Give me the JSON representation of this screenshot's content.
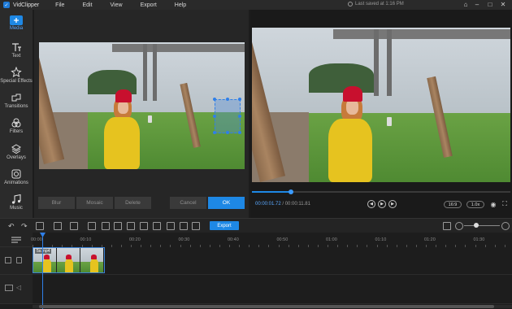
{
  "app": {
    "name": "VidClipper",
    "saved_status": "Last saved at 1:16 PM"
  },
  "menu": [
    "File",
    "Edit",
    "View",
    "Export",
    "Help"
  ],
  "sidebar": {
    "items": [
      {
        "label": "Media",
        "icon": "media-plus-icon",
        "active": true
      },
      {
        "label": "Text",
        "icon": "text-icon",
        "active": false
      },
      {
        "label": "Special Effects",
        "icon": "special-effects-icon",
        "active": false
      },
      {
        "label": "Transitions",
        "icon": "transitions-icon",
        "active": false
      },
      {
        "label": "Filters",
        "icon": "filters-icon",
        "active": false
      },
      {
        "label": "Overlays",
        "icon": "overlays-icon",
        "active": false
      },
      {
        "label": "Animations",
        "icon": "animations-icon",
        "active": false
      },
      {
        "label": "Music",
        "icon": "music-icon",
        "active": false
      }
    ]
  },
  "editor": {
    "buttons": {
      "blur": "Blur",
      "mosaic": "Mosaic",
      "delete": "Delete",
      "cancel": "Cancel",
      "ok": "OK"
    }
  },
  "preview": {
    "current_time": "00:00:01.72",
    "separator": " / ",
    "total_time": "00:00:11.81",
    "progress_fraction": 0.15,
    "aspect_ratio": "16:9",
    "speed": "1.0x"
  },
  "toolbar": {
    "export_label": "Export"
  },
  "timeline": {
    "ruler_labels": [
      "00:00",
      "00:10",
      "00:20",
      "00:30",
      "00:40",
      "00:50",
      "01:00",
      "01:10",
      "01:20",
      "01:30"
    ],
    "clip_label": "5s.mp4"
  },
  "colors": {
    "accent": "#1e88e5",
    "background": "#1c1c1c",
    "panel": "#262626"
  }
}
